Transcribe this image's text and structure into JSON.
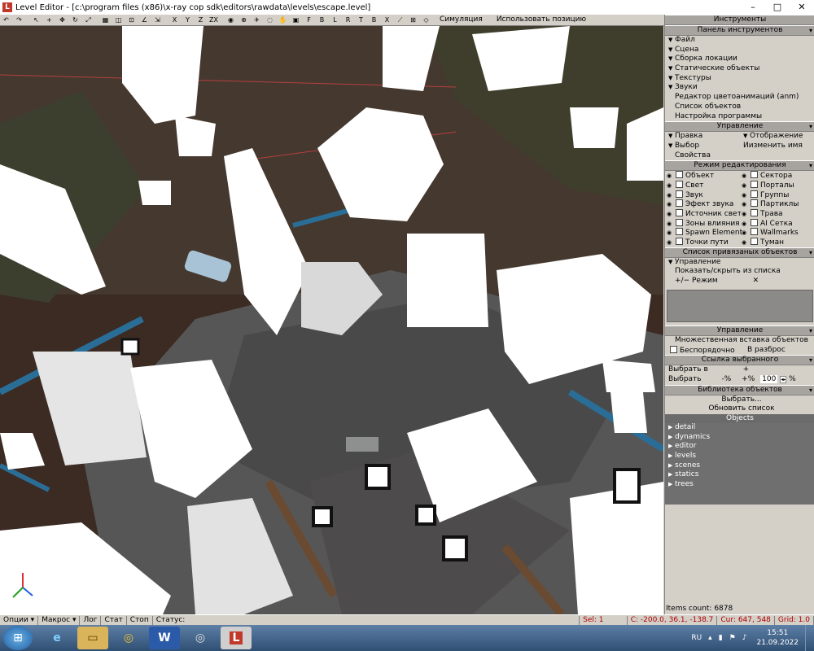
{
  "window": {
    "title": "Level Editor - [c:\\program files (x86)\\x-ray cop sdk\\editors\\rawdata\\levels\\escape.level]",
    "minimize": "–",
    "maximize": "□",
    "close": "✕"
  },
  "toolbar": {
    "axes": [
      "X",
      "Y",
      "Z",
      "ZX"
    ],
    "views": [
      "F",
      "B",
      "L",
      "R",
      "T",
      "B",
      "X"
    ],
    "simulation": "Симуляция",
    "use_position": "Использовать позицию"
  },
  "panel": {
    "title": "Инструменты",
    "sections": {
      "toolbar_header": "Панель инструментов",
      "toolbar_items": [
        "Файл",
        "Сцена",
        "Сборка локации",
        "Статические объекты",
        "Текстуры",
        "Звуки"
      ],
      "toolbar_links": [
        "Редактор цветоанимаций (anm)",
        "Список объектов",
        "Настройка программы"
      ],
      "control_header": "Управление",
      "control_left": [
        "Правка",
        "Выбор"
      ],
      "control_left_extra": "Свойства",
      "control_right": [
        "Отображение"
      ],
      "control_right_extra": "Иизменить имя",
      "edit_mode_header": "Режим редактирования",
      "edit_modes_left": [
        "Объект",
        "Свет",
        "Звук",
        "Эфект звука",
        "Источник свет",
        "Зоны влияния",
        "Spawn Element",
        "Точки пути"
      ],
      "edit_modes_right": [
        "Сектора",
        "Порталы",
        "Группы",
        "Партиклы",
        "Трава",
        "AI Сетка",
        "Wallmarks",
        "Туман"
      ],
      "snap_header": "Список привязаных объектов",
      "snap_control": "Управление",
      "snap_toggle": "Показать/скрыть из списка",
      "snap_mode": "+/− Режим",
      "snap_clear": "✕",
      "control2_header": "Управление",
      "multi_insert": "Множественная вставка объектов",
      "random_order": "Беспорядочно",
      "scatter": "В разброс",
      "selected_link_header": "Ссылка выбранного",
      "select_in": "Выбрать в",
      "select": "Выбрать",
      "pct_minus": "-%",
      "pct_plus": "+%",
      "pct_value": "100",
      "pct_sign": "%",
      "library_header": "Библиотека объектов",
      "choose": "Выбрать...",
      "refresh": "Обновить список",
      "objects_header": "Objects",
      "objects": [
        "detail",
        "dynamics",
        "editor",
        "levels",
        "scenes",
        "statics",
        "trees"
      ]
    }
  },
  "status": {
    "options": "Опции",
    "macros": "Макрос",
    "log": "Лог",
    "stat": "Стат",
    "stop": "Стоп",
    "status_label": "Статус:",
    "sel": "Sel: 1",
    "coords": "C: -200.0, 36.1, -138.7",
    "cursor": "Cur: 647, 548",
    "grid": "Grid: 1.0",
    "items_count": "Items count: 6878"
  },
  "taskbar": {
    "lang": "RU",
    "time": "15:51",
    "date": "21.09.2022"
  },
  "colors": {
    "panel_bg": "#d4d0c8",
    "header_bg": "#a7a4a0",
    "viewport_ground": "#3b2b22",
    "red_status": "#b00000"
  }
}
